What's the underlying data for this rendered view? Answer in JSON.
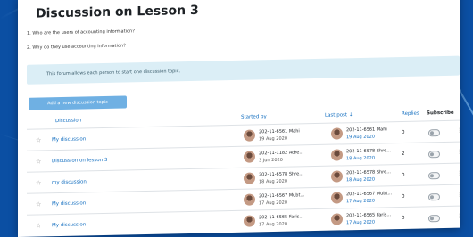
{
  "page_title": "Discussion on Lesson 3",
  "questions": [
    "1. Who are the users of accounting information?",
    "2. Why do they use accounting information?"
  ],
  "info_note": "This forum allows each person to start one discussion topic.",
  "add_button_label": "Add a new discussion topic",
  "table": {
    "headers": {
      "discussion": "Discussion",
      "started_by": "Started by",
      "last_post": "Last post ↓",
      "replies": "Replies",
      "subscribe": "Subscribe"
    },
    "rows": [
      {
        "topic": "My discussion",
        "starter": "202-11-6561 Mahi",
        "start_date": "19 Aug 2020",
        "last_user": "202-11-6561 Mahi",
        "last_date": "19 Aug 2020",
        "replies": "0"
      },
      {
        "topic": "Discussion on lesson 3",
        "starter": "202-11-1182 Adre...",
        "start_date": "3 Jun 2020",
        "last_user": "202-11-6578 Shre...",
        "last_date": "18 Aug 2020",
        "replies": "2"
      },
      {
        "topic": "my discussion",
        "starter": "202-11-6578 Shre...",
        "start_date": "18 Aug 2020",
        "last_user": "202-11-6578 Shre...",
        "last_date": "18 Aug 2020",
        "replies": "0"
      },
      {
        "topic": "My discussion",
        "starter": "202-11-6567 Mubt...",
        "start_date": "17 Aug 2020",
        "last_user": "202-11-6567 Mubt...",
        "last_date": "17 Aug 2020",
        "replies": "0"
      },
      {
        "topic": "My discussion",
        "starter": "202-11-6565 Faris...",
        "start_date": "17 Aug 2020",
        "last_user": "202-11-6565 Faris...",
        "last_date": "17 Aug 2020",
        "replies": "0"
      }
    ]
  },
  "colors": {
    "link": "#0f6cbf",
    "accent_button": "#6fb0e3",
    "info_bg": "#dbeef6",
    "background": "#0b4fa3"
  }
}
